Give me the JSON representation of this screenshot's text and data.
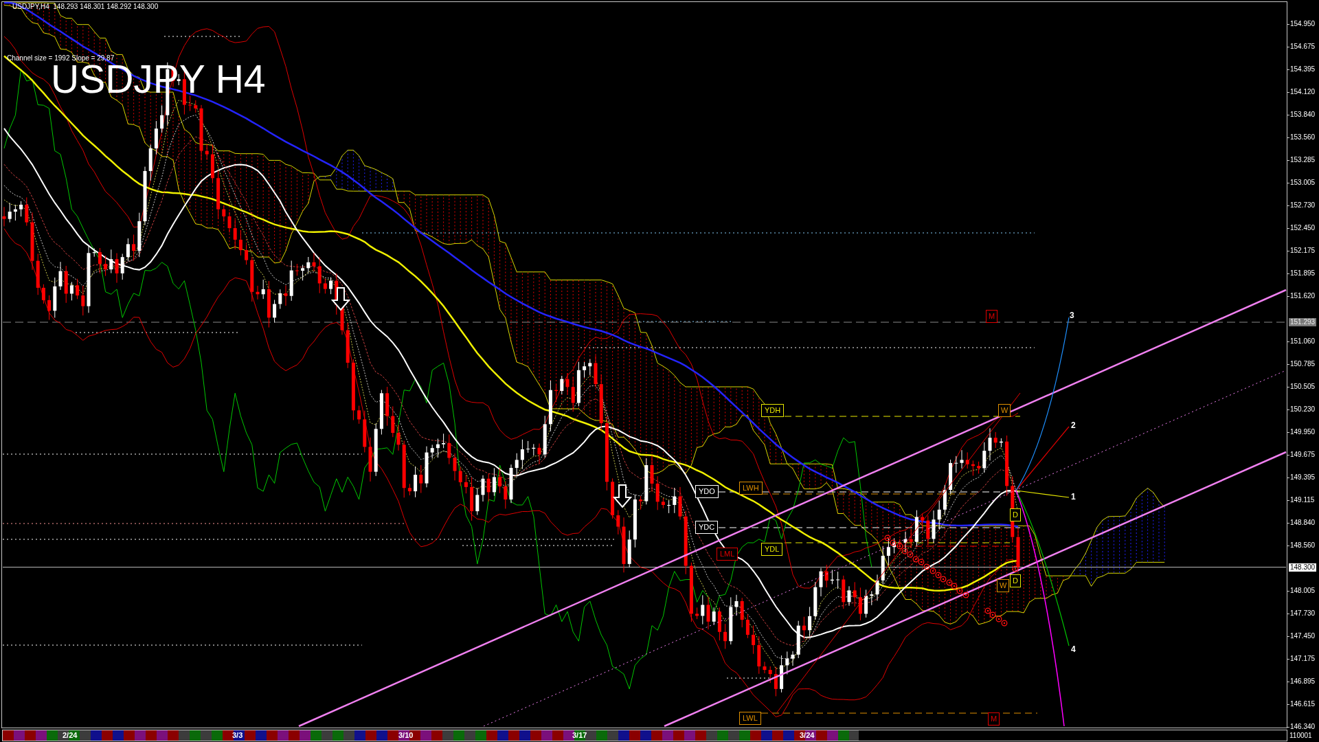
{
  "header": {
    "quote": "USDJPY,H4  148.293 148.301 148.292 148.300",
    "channel": "Channel size = 1992 Slope = 29.87",
    "title": "USDJPY H4"
  },
  "chart": {
    "level_tags": [
      {
        "text": "YDH",
        "color": "#e8e800"
      },
      {
        "text": "YDO",
        "color": "#ffffff"
      },
      {
        "text": "LWH",
        "color": "#e09000"
      },
      {
        "text": "YDC",
        "color": "#ffffff"
      },
      {
        "text": "LML",
        "color": "#e00000"
      },
      {
        "text": "YDL",
        "color": "#e8e800"
      },
      {
        "text": "LWL",
        "color": "#e09000"
      }
    ],
    "period_tags": [
      {
        "text": "M",
        "color": "#e00000"
      },
      {
        "text": "W",
        "color": "#e09000"
      },
      {
        "text": "D",
        "color": "#e8e800"
      },
      {
        "text": "W",
        "color": "#e09000"
      },
      {
        "text": "D",
        "color": "#e8e800"
      },
      {
        "text": "M",
        "color": "#e00000"
      }
    ],
    "projection_labels": [
      "3",
      "2",
      "1",
      "4"
    ]
  },
  "price_axis": {
    "labels": [
      "154.950",
      "154.675",
      "154.395",
      "154.120",
      "153.840",
      "153.560",
      "153.285",
      "153.005",
      "152.730",
      "152.450",
      "152.175",
      "151.895",
      "151.620",
      "151.060",
      "150.785",
      "150.505",
      "150.230",
      "149.950",
      "149.675",
      "149.395",
      "149.115",
      "148.840",
      "148.560",
      "148.005",
      "147.730",
      "147.450",
      "147.175",
      "146.895",
      "146.615",
      "146.340"
    ],
    "marked_price": "151.293",
    "current_price": "148.300"
  },
  "time_axis": {
    "labels": [
      "2/24",
      "3/3",
      "3/10",
      "3/17",
      "3/24"
    ]
  },
  "footer": {
    "value": "110001"
  }
}
